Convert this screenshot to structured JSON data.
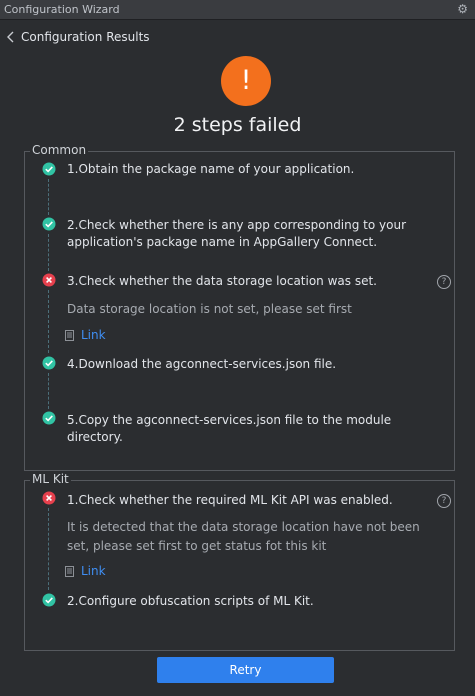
{
  "window": {
    "title": "Configuration Wizard",
    "settings_icon": "gear-icon"
  },
  "header": {
    "back_icon": "chevron-left-icon",
    "title": "Configuration Results"
  },
  "summary": {
    "icon": "exclamation-icon",
    "mark": "!",
    "headline": "2 steps failed",
    "accent_color": "#f3701d"
  },
  "groups": [
    {
      "label": "Common",
      "steps": [
        {
          "status": "success",
          "text": "1.Obtain the package name of your application."
        },
        {
          "status": "success",
          "text": "2.Check whether there is any app corresponding to your application's package name in AppGallery Connect."
        },
        {
          "status": "error",
          "text": "3.Check whether the data storage location was set.",
          "detail": "Data storage location is not set, please set first",
          "link_label": "Link",
          "help": "?"
        },
        {
          "status": "success",
          "text": "4.Download the agconnect-services.json file."
        },
        {
          "status": "success",
          "text": "5.Copy the agconnect-services.json file to the module directory."
        }
      ]
    },
    {
      "label": "ML Kit",
      "steps": [
        {
          "status": "error",
          "text": "1.Check whether the required ML Kit API was enabled.",
          "detail": "It is detected that the data storage location have not been set, please set first to get status fot this kit",
          "link_label": "Link",
          "help": "?"
        },
        {
          "status": "success",
          "text": "2.Configure obfuscation scripts of ML Kit."
        }
      ]
    }
  ],
  "actions": {
    "retry_label": "Retry"
  },
  "colors": {
    "success": "#31c3a4",
    "error": "#e6404d",
    "link": "#3f8ef3",
    "primary_button": "#2f80ed"
  }
}
